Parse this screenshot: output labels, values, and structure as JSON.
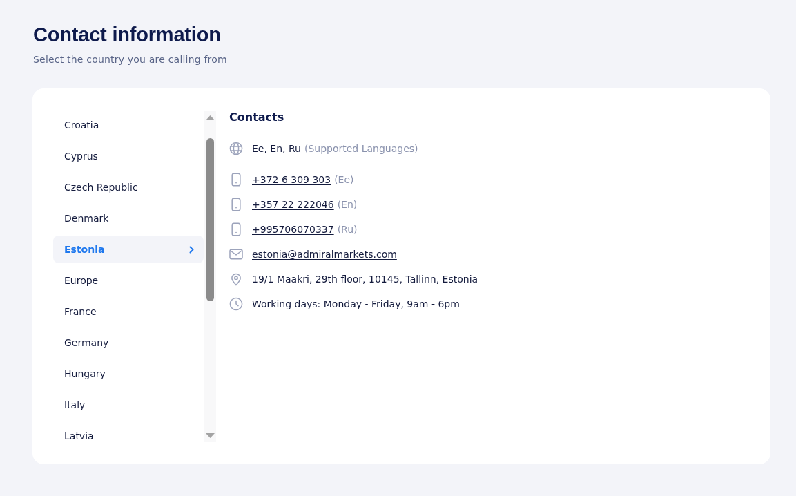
{
  "header": {
    "title": "Contact information",
    "subtitle": "Select the country you are calling from"
  },
  "countries": [
    {
      "label": "Croatia",
      "selected": false
    },
    {
      "label": "Cyprus",
      "selected": false
    },
    {
      "label": "Czech Republic",
      "selected": false
    },
    {
      "label": "Denmark",
      "selected": false
    },
    {
      "label": "Estonia",
      "selected": true
    },
    {
      "label": "Europe",
      "selected": false
    },
    {
      "label": "France",
      "selected": false
    },
    {
      "label": "Germany",
      "selected": false
    },
    {
      "label": "Hungary",
      "selected": false
    },
    {
      "label": "Italy",
      "selected": false
    },
    {
      "label": "Latvia",
      "selected": false
    }
  ],
  "contacts": {
    "title": "Contacts",
    "items": [
      {
        "kind": "languages",
        "value": "Ee, En, Ru",
        "note": "(Supported Languages)"
      },
      {
        "kind": "phone",
        "value": "+372 6 309 303",
        "note": "(Ee)"
      },
      {
        "kind": "phone",
        "value": "+357 22 222046",
        "note": "(En)"
      },
      {
        "kind": "phone",
        "value": "+995706070337",
        "note": "(Ru)"
      },
      {
        "kind": "email",
        "value": "estonia@admiralmarkets.com"
      },
      {
        "kind": "address",
        "value": "19/1 Maakri, 29th floor, 10145, Tallinn, Estonia"
      },
      {
        "kind": "hours",
        "value": "Working days: Monday - Friday, 9am - 6pm"
      }
    ]
  }
}
